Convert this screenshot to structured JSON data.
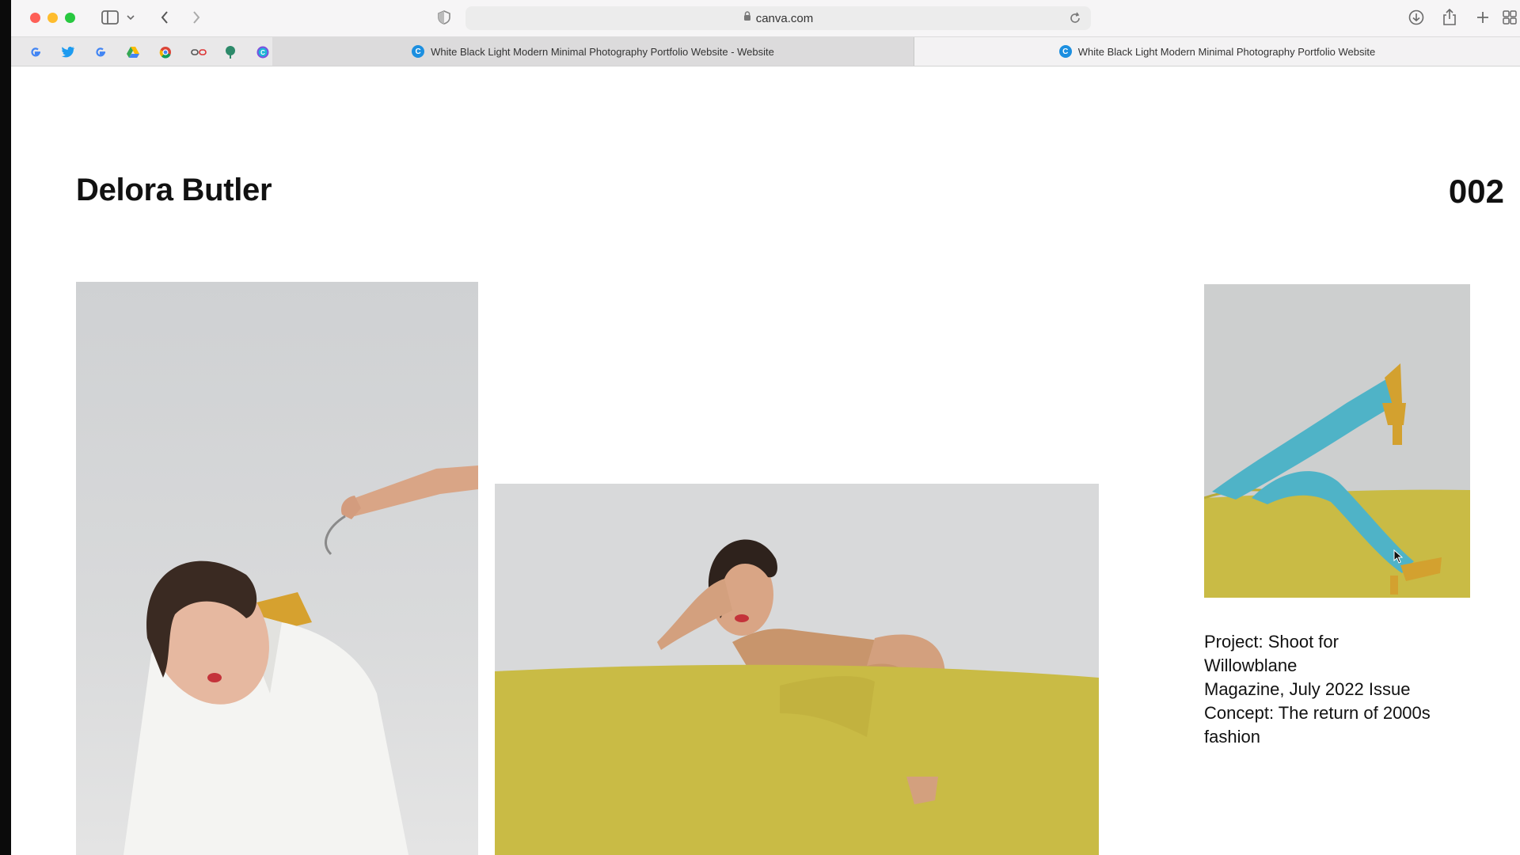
{
  "browser": {
    "url": "canva.com",
    "tabs": [
      {
        "label": "White Black Light Modern Minimal Photography Portfolio Website - Website",
        "active": false
      },
      {
        "label": "White Black Light Modern Minimal Photography Portfolio Website",
        "active": true
      }
    ],
    "favorites": [
      "google-icon",
      "twitter-icon",
      "google-icon",
      "drive-icon",
      "chrome-icon",
      "link-icon",
      "tree-icon",
      "canva-icon"
    ]
  },
  "page": {
    "brand": "Delora Butler",
    "page_number": "002",
    "caption": [
      "Project: Shoot for",
      "Willowblane",
      "Magazine, July 2022 Issue",
      "Concept: The return of 2000s",
      "fashion"
    ]
  },
  "colors": {
    "mustard": "#c9bb45",
    "teal": "#4fb3c7",
    "backdrop": "#d8d9da"
  }
}
